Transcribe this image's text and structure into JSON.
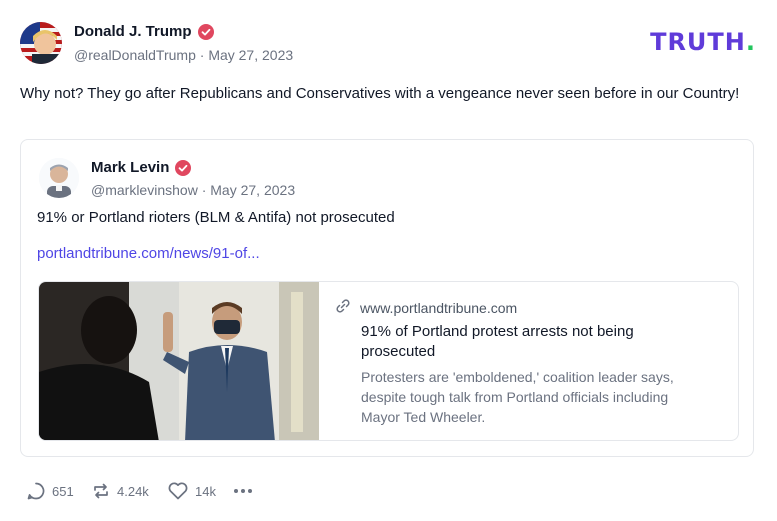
{
  "brand": {
    "wordmark": "TRUTH",
    "dot": ".",
    "color": "#5f3bd9",
    "dot_color": "#22c55e"
  },
  "post": {
    "author": {
      "name": "Donald J. Trump",
      "handle": "@realDonaldTrump",
      "separator": "·",
      "date": "May 27, 2023"
    },
    "text": "Why not? They go after Republicans and Conservatives with a vengeance never seen before in our Country!",
    "verified_color": "#e0475f",
    "quote": {
      "author": {
        "name": "Mark Levin",
        "handle": "@marklevinshow",
        "separator": "·",
        "date": "May 27, 2023"
      },
      "text": "91% or Portland rioters (BLM & Antifa) not prosecuted",
      "link": "portlandtribune.com/news/91-of...",
      "card": {
        "domain": "www.portlandtribune.com",
        "title": "91% of Portland protest arrests not being prosecuted",
        "description": "Protesters are 'emboldened,' coalition leader says, despite tough talk from Portland officials including Mayor Ted Wheeler."
      }
    },
    "actions": {
      "replies": "651",
      "reposts": "4.24k",
      "likes": "14k",
      "more_icon": "ellipsis-icon"
    }
  }
}
